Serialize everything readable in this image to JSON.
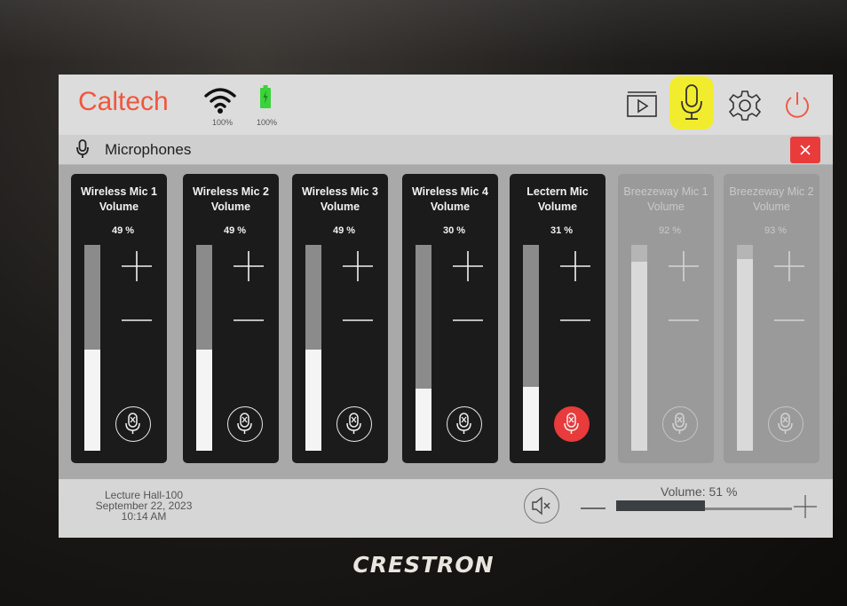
{
  "header": {
    "logo": "Caltech",
    "wifi_label": "100%",
    "battery_label": "100%",
    "icons": [
      "wifi-icon",
      "battery-icon",
      "video-source-icon",
      "microphone-icon",
      "gear-icon",
      "power-icon"
    ],
    "highlight_color": "#f2ec2e",
    "logo_color": "#f0563d"
  },
  "page": {
    "title": "Microphones",
    "close_icon": "close-icon",
    "close_color": "#ea3b3b"
  },
  "mics": [
    {
      "title": "Wireless Mic 1 Volume",
      "percent": "49 %",
      "level": 0.49,
      "muted": false,
      "dimmed": false
    },
    {
      "title": "Wireless Mic 2 Volume",
      "percent": "49 %",
      "level": 0.49,
      "muted": false,
      "dimmed": false
    },
    {
      "title": "Wireless Mic 3 Volume",
      "percent": "49 %",
      "level": 0.49,
      "muted": false,
      "dimmed": false
    },
    {
      "title": "Wireless Mic 4 Volume",
      "percent": "30 %",
      "level": 0.3,
      "muted": false,
      "dimmed": false
    },
    {
      "title": "Lectern Mic Volume",
      "percent": "31 %",
      "level": 0.31,
      "muted": true,
      "dimmed": false
    },
    {
      "title": "Breezeway Mic 1 Volume",
      "percent": "92 %",
      "level": 0.92,
      "muted": false,
      "dimmed": true
    },
    {
      "title": "Breezeway Mic 2 Volume",
      "percent": "93 %",
      "level": 0.93,
      "muted": false,
      "dimmed": true
    }
  ],
  "footer": {
    "room": "Lecture Hall-100",
    "date": "September 22, 2023",
    "time": "10:14 AM",
    "volume_label": "Volume: 51 %",
    "volume_level": 0.51
  },
  "device": {
    "brand": "CRESTRON"
  }
}
